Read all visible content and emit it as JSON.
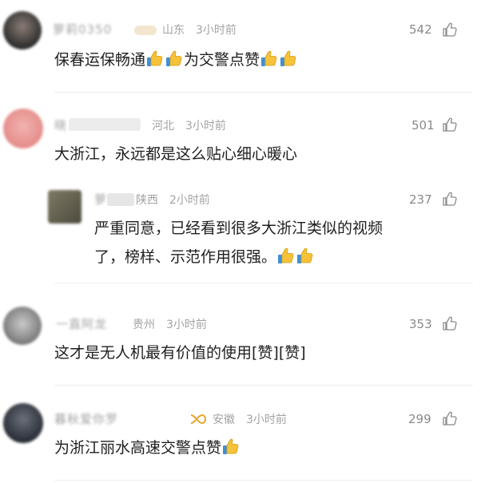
{
  "comments": [
    {
      "name": "萝莉0350",
      "location": "山东",
      "time": "3小时前",
      "likes": "542",
      "text": "保春运保畅通",
      "text2": "为交警点赞",
      "avatar_color": "#4a4a4a"
    },
    {
      "name": "晓",
      "location": "河北",
      "time": "3小时前",
      "likes": "501",
      "text": "大浙江，永远都是这么贴心细心暖心",
      "avatar_color": "#e89a9a"
    },
    {
      "name": "萝",
      "location": "陕西",
      "time": "2小时前",
      "likes": "237",
      "text_line1": "严重同意，已经看到很多大浙江类似的视频",
      "text_line2": "了，榜样、示范作用很强。",
      "avatar_color": "#6b6a5a"
    },
    {
      "name": "一直阿龙",
      "location": "贵州",
      "time": "3小时前",
      "likes": "353",
      "text": "这才是无人机最有价值的使用[赞][赞]",
      "avatar_color": "#8a8a8a"
    },
    {
      "name": "暮秋爱你罗",
      "location": "安徽",
      "time": "3小时前",
      "likes": "299",
      "text": "为浙江丽水高速交警点赞",
      "avatar_color": "#3a3f4a"
    }
  ]
}
